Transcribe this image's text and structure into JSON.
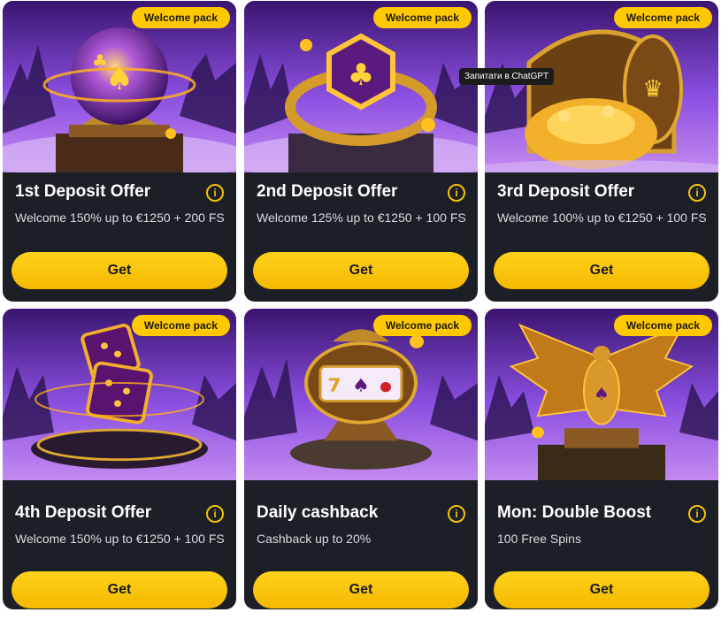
{
  "cards": [
    {
      "badge": "Welcome pack",
      "title": "1st Deposit Offer",
      "desc": "Welcome 150% up to €1250 + 200 FS",
      "button": "Get",
      "art": "crystal-ball"
    },
    {
      "badge": "Welcome pack",
      "title": "2nd Deposit Offer",
      "desc": "Welcome 125% up to €1250 + 100 FS",
      "button": "Get",
      "art": "ring"
    },
    {
      "badge": "Welcome pack",
      "title": "3rd Deposit Offer",
      "desc": "Welcome 100% up to €1250 + 100 FS",
      "button": "Get",
      "art": "treasure-vault"
    },
    {
      "badge": "Welcome pack",
      "title": "4th Deposit Offer",
      "desc": "Welcome 150% up to €1250 + 100 FS",
      "button": "Get",
      "art": "dice"
    },
    {
      "badge": "Welcome pack",
      "title": "Daily cashback",
      "desc": "Cashback up to 20%",
      "button": "Get",
      "art": "slot-machine"
    },
    {
      "badge": "Welcome pack",
      "title": "Mon: Double Boost",
      "desc": "100 Free Spins",
      "button": "Get",
      "art": "phoenix"
    }
  ],
  "info_icon": "i",
  "tooltip": "Запитати в ChatGPT",
  "colors": {
    "accent": "#ffc800",
    "card_bg": "#1c1f26",
    "sky": "#7a3fd0"
  }
}
